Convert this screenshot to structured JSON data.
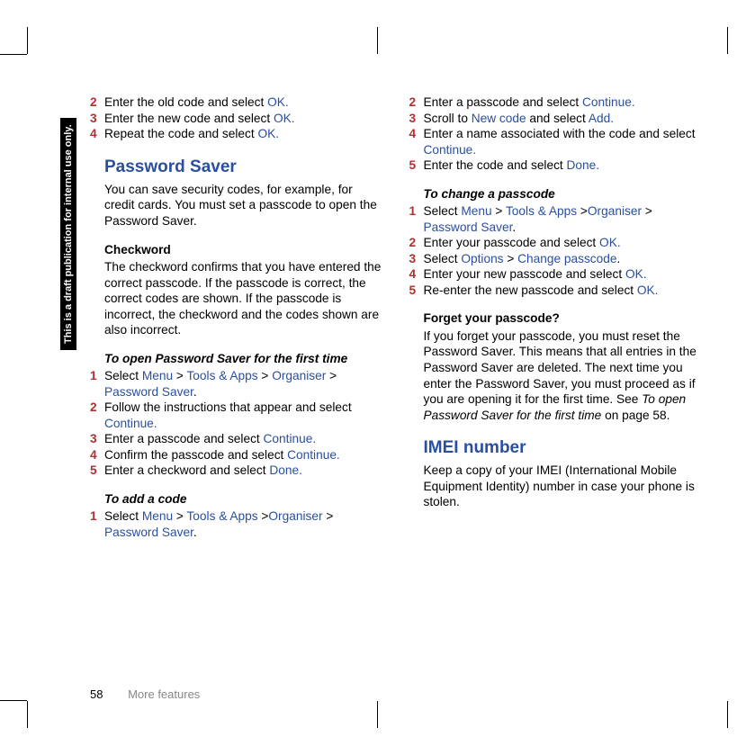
{
  "draft_label": "This is a draft publication for internal use only.",
  "left": {
    "steps_a": [
      {
        "n": "2",
        "t": "Enter the old code and select ",
        "a": "OK."
      },
      {
        "n": "3",
        "t": "Enter the new code and select ",
        "a": "OK."
      },
      {
        "n": "4",
        "t": "Repeat the code and select ",
        "a": "OK."
      }
    ],
    "h_password_saver": "Password Saver",
    "p_password_saver": "You can save security codes, for example, for credit cards. You must set a passcode to open the Password Saver.",
    "h_checkword": "Checkword",
    "p_checkword": "The checkword confirms that you have entered the correct passcode. If the passcode is correct, the correct codes are shown. If the passcode is incorrect, the checkword and the codes shown are also incorrect.",
    "h_open_first": "To open Password Saver for the first time",
    "steps_b": [
      {
        "n": "1",
        "pre": "Select ",
        "parts": [
          "Menu",
          " > ",
          "Tools & Apps",
          " > ",
          "Organiser",
          " > ",
          "Password Saver",
          "."
        ]
      },
      {
        "n": "2",
        "t": "Follow the instructions that appear and select ",
        "a": "Continue."
      },
      {
        "n": "3",
        "t": "Enter a passcode and select ",
        "a": "Continue."
      },
      {
        "n": "4",
        "t": "Confirm the passcode and select ",
        "a": "Continue."
      },
      {
        "n": "5",
        "t": "Enter a checkword and select ",
        "a": "Done."
      }
    ],
    "h_add_code": "To add a code",
    "steps_c": [
      {
        "n": "1",
        "pre": "Select ",
        "parts": [
          "Menu",
          " > ",
          "Tools & Apps",
          " >",
          "Organiser",
          " > ",
          "Password Saver",
          "."
        ]
      }
    ]
  },
  "right": {
    "steps_d": [
      {
        "n": "2",
        "t": "Enter a passcode and select ",
        "a": "Continue."
      },
      {
        "n": "3",
        "t1": "Scroll to ",
        "a1": "New code",
        "t2": " and select ",
        "a2": "Add."
      },
      {
        "n": "4",
        "t": "Enter a name associated with the code and select ",
        "a": "Continue."
      },
      {
        "n": "5",
        "t": "Enter the code and select ",
        "a": "Done."
      }
    ],
    "h_change": "To change a passcode",
    "steps_e": [
      {
        "n": "1",
        "pre": "Select ",
        "parts": [
          "Menu",
          " > ",
          "Tools & Apps",
          " >",
          "Organiser",
          " > ",
          "Password Saver",
          "."
        ]
      },
      {
        "n": "2",
        "t": "Enter your passcode and select ",
        "a": "OK."
      },
      {
        "n": "3",
        "pre": "Select ",
        "parts": [
          "Options",
          " > ",
          "Change passcode",
          "."
        ]
      },
      {
        "n": "4",
        "t": "Enter your new passcode and select ",
        "a": "OK."
      },
      {
        "n": "5",
        "t": "Re-enter the new passcode and select ",
        "a": "OK."
      }
    ],
    "h_forget": "Forget your passcode?",
    "p_forget1": "If you forget your passcode, you must reset the Password Saver. This means that all entries in the Password Saver are deleted. The next time you enter the Password Saver, you must proceed as if you are opening it for the first time. See ",
    "p_forget_ital": "To open Password Saver for the first time",
    "p_forget2": " on page 58.",
    "h_imei": "IMEI number",
    "p_imei": "Keep a copy of your IMEI (International Mobile Equipment Identity) number in case your phone is stolen."
  },
  "footer": {
    "page": "58",
    "section": "More features"
  }
}
